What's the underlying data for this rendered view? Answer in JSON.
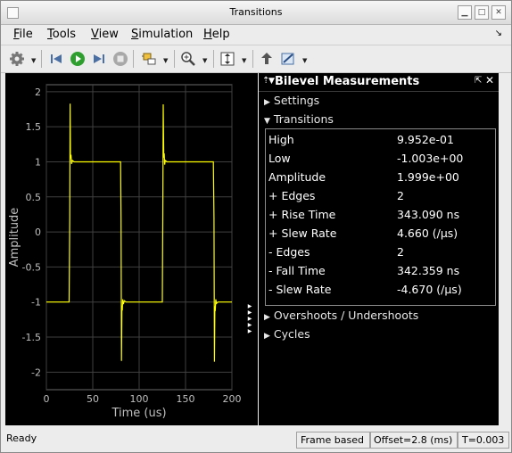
{
  "window": {
    "title": "Transitions"
  },
  "menu": [
    {
      "label": "File",
      "ul": "F",
      "rest": "ile"
    },
    {
      "label": "Tools",
      "ul": "T",
      "rest": "ools"
    },
    {
      "label": "View",
      "ul": "V",
      "rest": "iew"
    },
    {
      "label": "Simulation",
      "ul": "S",
      "rest": "imulation"
    },
    {
      "label": "Help",
      "ul": "H",
      "rest": "elp"
    }
  ],
  "toolbar": {
    "icons": [
      "gear-icon",
      "step-back-icon",
      "run-icon",
      "step-forward-icon",
      "stop-icon",
      "highlight-simulink-block-icon",
      "zoom-in-icon",
      "scale-axes-icon",
      "dock-icon",
      "measurement-icon"
    ]
  },
  "colors": {
    "signal": "#ffff00",
    "plot_bg": "#000000",
    "grid": "#404040",
    "axis_text": "#bfbfbf",
    "run_green": "#2e9e2e"
  },
  "chart_data": {
    "type": "line",
    "title": "",
    "xlabel": "Time (us)",
    "ylabel": "Amplitude",
    "xlim": [
      0,
      200
    ],
    "ylim": [
      -2.25,
      2.1
    ],
    "xticks": [
      0,
      50,
      100,
      150,
      200
    ],
    "yticks": [
      -2,
      -1.5,
      -1,
      -0.5,
      0,
      0.5,
      1,
      1.5,
      2
    ],
    "grid": true,
    "series": [
      {
        "color": "#ffff00",
        "x": [
          0,
          24.5,
          25.2,
          25.6,
          26,
          26.5,
          27.2,
          28,
          30,
          80,
          80.5,
          81,
          81.4,
          81.8,
          82.3,
          83,
          84,
          86,
          125,
          125.5,
          126,
          126.5,
          127,
          127.5,
          128.2,
          130,
          180,
          180.7,
          181.2,
          181.6,
          182,
          182.6,
          183.4,
          185,
          200
        ],
        "y": [
          -1,
          -1,
          0.2,
          1.83,
          1.05,
          1.1,
          0.97,
          1.02,
          1,
          1,
          0.2,
          -1.84,
          -1.05,
          -1.12,
          -0.96,
          -1.03,
          -0.98,
          -1,
          -1,
          0.2,
          1.82,
          1.06,
          1.12,
          0.96,
          1.02,
          1,
          1,
          0.2,
          -1.85,
          -1.06,
          -1.13,
          -0.96,
          -1.02,
          -1,
          -1
        ]
      }
    ]
  },
  "panel": {
    "title": "Bilevel Measurements",
    "sections": {
      "settings": "Settings",
      "transitions": "Transitions",
      "overshoots": "Overshoots / Undershoots",
      "cycles": "Cycles"
    },
    "rows": [
      {
        "label": "High",
        "value": "9.952e-01"
      },
      {
        "label": "Low",
        "value": "-1.003e+00"
      },
      {
        "label": "Amplitude",
        "value": "1.999e+00"
      },
      {
        "label": "+ Edges",
        "value": "2"
      },
      {
        "label": "+ Rise Time",
        "value": "343.090 ns"
      },
      {
        "label": "+ Slew Rate",
        "value": "4.660 (/μs)"
      },
      {
        "label": "- Edges",
        "value": "2"
      },
      {
        "label": "- Fall Time",
        "value": "342.359 ns"
      },
      {
        "label": "- Slew Rate",
        "value": "-4.670 (/μs)"
      }
    ]
  },
  "status": {
    "left": "Ready",
    "mode": "Frame based",
    "offset": "Offset=2.8 (ms)",
    "time": "T=0.003"
  }
}
